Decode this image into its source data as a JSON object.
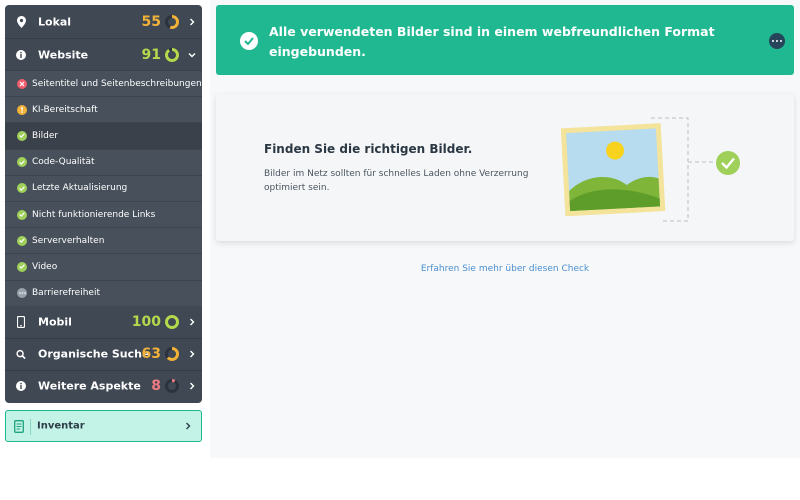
{
  "sidebar": {
    "categories": [
      {
        "label": "Lokal",
        "score": "55",
        "score_color": "#f2b23a",
        "progress": 0.55,
        "icon": "map-pin-icon",
        "expanded": false
      },
      {
        "label": "Website",
        "score": "91",
        "score_color": "#b5d94d",
        "progress": 0.91,
        "icon": "info-circle-icon",
        "expanded": true
      },
      {
        "label": "Mobil",
        "score": "100",
        "score_color": "#b5d94d",
        "progress": 1.0,
        "icon": "smartphone-icon",
        "expanded": false
      },
      {
        "label": "Organische Suche",
        "score": "63",
        "score_color": "#f2b23a",
        "progress": 0.63,
        "icon": "search-icon",
        "expanded": false
      },
      {
        "label": "Weitere Aspekte",
        "score": "8",
        "score_color": "#f07a82",
        "progress": 0.08,
        "icon": "info-circle-icon",
        "expanded": false
      }
    ],
    "website_items": [
      {
        "label": "Seitentitel und Seitenbeschreibungen",
        "status": "error"
      },
      {
        "label": "KI-Bereitschaft",
        "status": "warning"
      },
      {
        "label": "Bilder",
        "status": "ok",
        "active": true
      },
      {
        "label": "Code-Qualität",
        "status": "ok"
      },
      {
        "label": "Letzte Aktualisierung",
        "status": "ok"
      },
      {
        "label": "Nicht funktionierende Links",
        "status": "ok"
      },
      {
        "label": "Serververhalten",
        "status": "ok"
      },
      {
        "label": "Video",
        "status": "ok"
      },
      {
        "label": "Barrierefreiheit",
        "status": "pending"
      }
    ]
  },
  "inventar": {
    "label": "Inventar"
  },
  "banner": {
    "message": "Alle verwendeten Bilder sind in einem webfreundlichen Format eingebunden."
  },
  "card": {
    "title": "Finden Sie die richtigen Bilder.",
    "description": "Bilder im Netz sollten für schnelles Laden ohne Verzerrung optimiert sein."
  },
  "learn_more": "Erfahren Sie mehr über diesen Check",
  "colors": {
    "accent": "#1fb890",
    "ok": "#9fd05a",
    "warning": "#f2b23a",
    "error": "#ef5c6b",
    "pending": "#9aa2ab"
  }
}
